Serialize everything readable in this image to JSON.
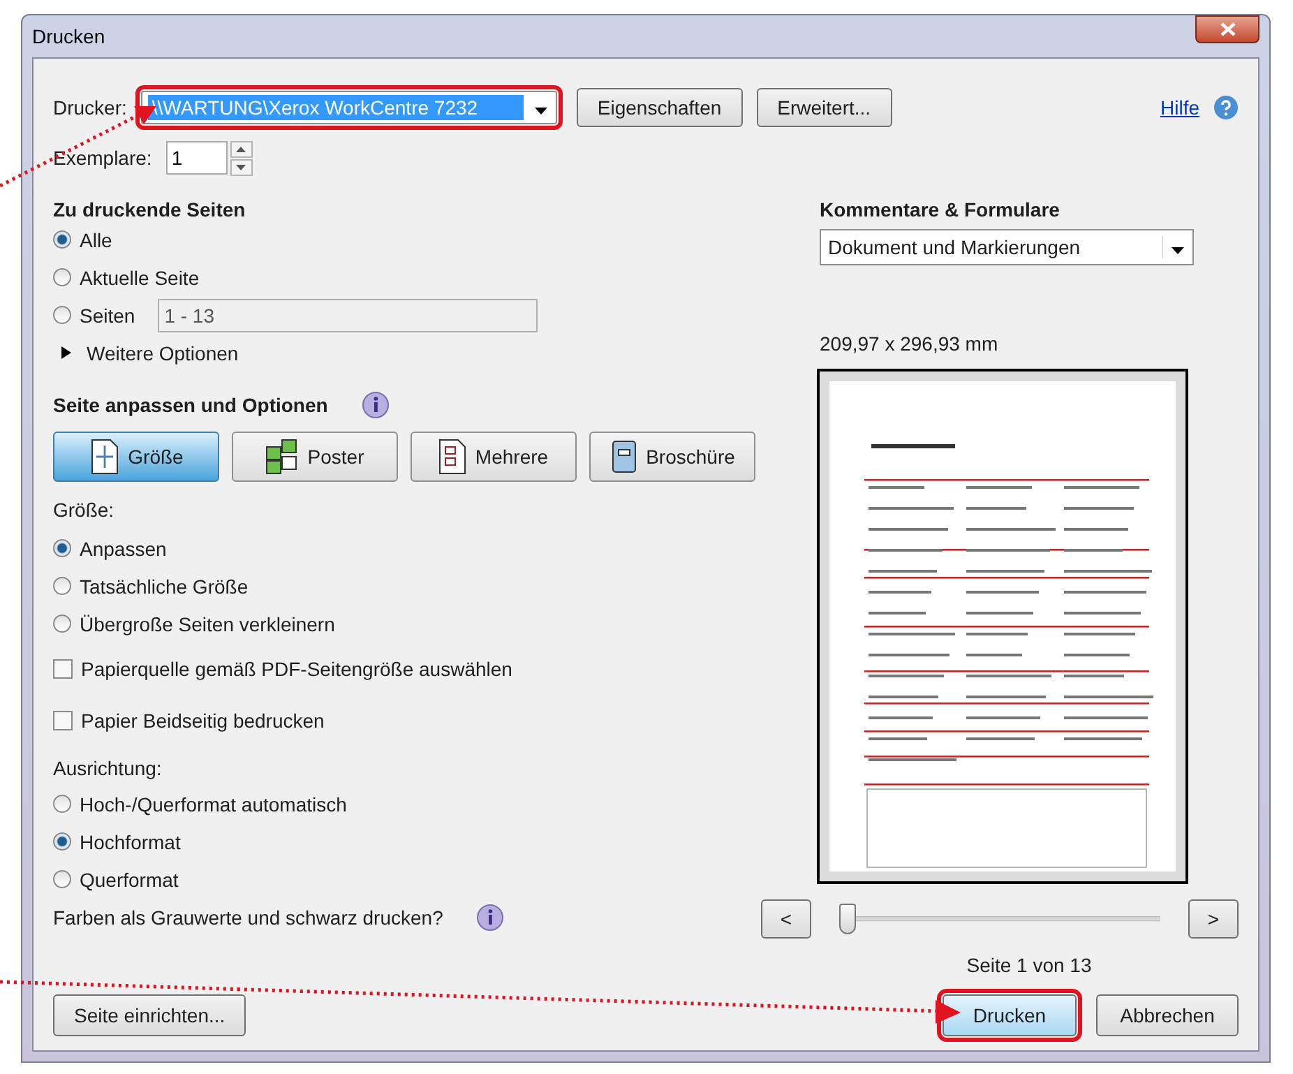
{
  "window": {
    "title": "Drucken"
  },
  "printer": {
    "label": "Drucker:",
    "value": "\\\\WARTUNG\\Xerox WorkCentre 7232",
    "highlighted": true
  },
  "top_buttons": [
    "Eigenschaften",
    "Erweitert..."
  ],
  "help": "Hilfe",
  "copies": {
    "label": "Exemplare:",
    "value": "1"
  },
  "pages": {
    "title": "Zu druckende Seiten",
    "options": [
      {
        "label": "Alle",
        "selected": true
      },
      {
        "label": "Aktuelle Seite",
        "selected": false
      },
      {
        "label": "Seiten",
        "selected": false
      }
    ],
    "range": {
      "value": "1 - 13",
      "disabled": true
    },
    "more": {
      "label": "Weitere Optionen",
      "expanded": false
    }
  },
  "fit": {
    "title": "Seite anpassen und Optionen",
    "tabs": [
      {
        "label": "Größe",
        "kind": "size",
        "selected": true
      },
      {
        "label": "Poster",
        "kind": "poster",
        "selected": false
      },
      {
        "label": "Mehrere",
        "kind": "multiple",
        "selected": false
      },
      {
        "label": "Broschüre",
        "kind": "booklet",
        "selected": false
      }
    ],
    "size_label": "Größe:",
    "size_options": [
      {
        "label": "Anpassen",
        "selected": true
      },
      {
        "label": "Tatsächliche Größe",
        "selected": false
      },
      {
        "label": "Übergroße Seiten verkleinern",
        "selected": false
      }
    ],
    "checkboxes": [
      {
        "label": "Papierquelle gemäß PDF-Seitengröße auswählen",
        "checked": false
      },
      {
        "label": "Papier Beidseitig bedrucken",
        "checked": false
      }
    ],
    "orientation_label": "Ausrichtung:",
    "orientation_options": [
      {
        "label": "Hoch-/Querformat automatisch",
        "selected": false
      },
      {
        "label": "Hochformat",
        "selected": true
      },
      {
        "label": "Querformat",
        "selected": false
      }
    ],
    "grayscale_label": "Farben als Grauwerte und schwarz drucken?"
  },
  "comments": {
    "title": "Kommentare & Formulare",
    "value": "Dokument und Markierungen"
  },
  "preview": {
    "page_size": "209,97 x 296,93 mm",
    "prev": "<",
    "next": ">",
    "slider": {
      "level": 0
    },
    "page_info": "Seite 1 von 13"
  },
  "bottom": {
    "page_setup": "Seite einrichten...",
    "print": {
      "label": "Drucken",
      "highlighted": true
    },
    "cancel": "Abbrechen"
  }
}
